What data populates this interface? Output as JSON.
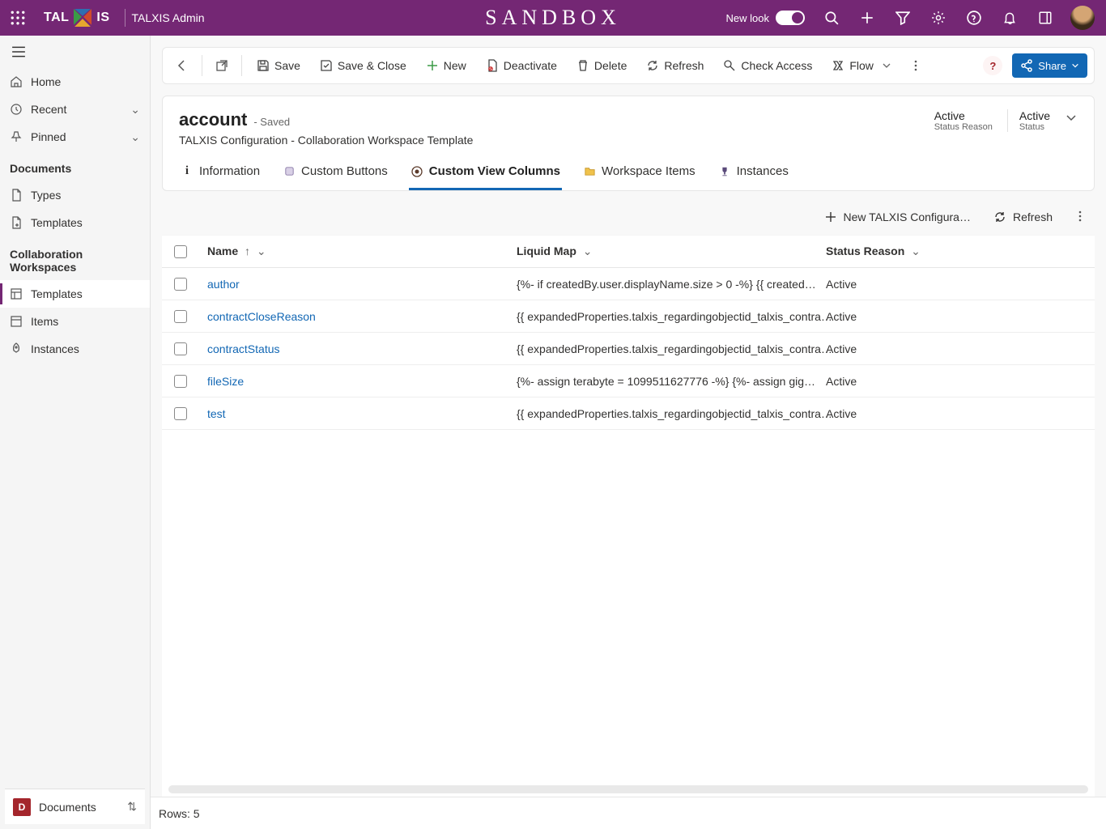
{
  "topbar": {
    "logo_text": "TALXIS",
    "app_name": "TALXIS Admin",
    "sandbox": "SANDBOX",
    "new_look": "New look"
  },
  "sidebar": {
    "home": "Home",
    "recent": "Recent",
    "pinned": "Pinned",
    "section_documents": "Documents",
    "types": "Types",
    "templates": "Templates",
    "section_collab": "Collaboration Workspaces",
    "cw_templates": "Templates",
    "cw_items": "Items",
    "cw_instances": "Instances",
    "bottom_letter": "D",
    "bottom_label": "Documents"
  },
  "commands": {
    "save": "Save",
    "save_close": "Save & Close",
    "new": "New",
    "deactivate": "Deactivate",
    "delete": "Delete",
    "refresh": "Refresh",
    "check_access": "Check Access",
    "flow": "Flow",
    "help": "?",
    "share": "Share"
  },
  "record": {
    "name": "account",
    "saved": "- Saved",
    "subtitle": "TALXIS Configuration - Collaboration Workspace Template",
    "status1_value": "Active",
    "status1_label": "Status Reason",
    "status2_value": "Active",
    "status2_label": "Status"
  },
  "tabs": {
    "info": "Information",
    "custom_buttons": "Custom Buttons",
    "custom_view_columns": "Custom View Columns",
    "workspace_items": "Workspace Items",
    "instances": "Instances"
  },
  "subcmd": {
    "new_config": "New TALXIS Configura…",
    "refresh": "Refresh"
  },
  "grid": {
    "col_name": "Name",
    "col_liquid": "Liquid Map",
    "col_status": "Status Reason",
    "rows": [
      {
        "name": "author",
        "liquid": "{%- if createdBy.user.displayName.size > 0 -%}      {{ created…",
        "status": "Active"
      },
      {
        "name": "contractCloseReason",
        "liquid": "{{ expandedProperties.talxis_regardingobjectid_talxis_contra…",
        "status": "Active"
      },
      {
        "name": "contractStatus",
        "liquid": "{{ expandedProperties.talxis_regardingobjectid_talxis_contra…",
        "status": "Active"
      },
      {
        "name": "fileSize",
        "liquid": "{%- assign terabyte = 1099511627776 -%}      {%- assign gig…",
        "status": "Active"
      },
      {
        "name": "test",
        "liquid": "{{ expandedProperties.talxis_regardingobjectid_talxis_contra…",
        "status": "Active"
      }
    ]
  },
  "footer": {
    "rows_label": "Rows: 5"
  }
}
